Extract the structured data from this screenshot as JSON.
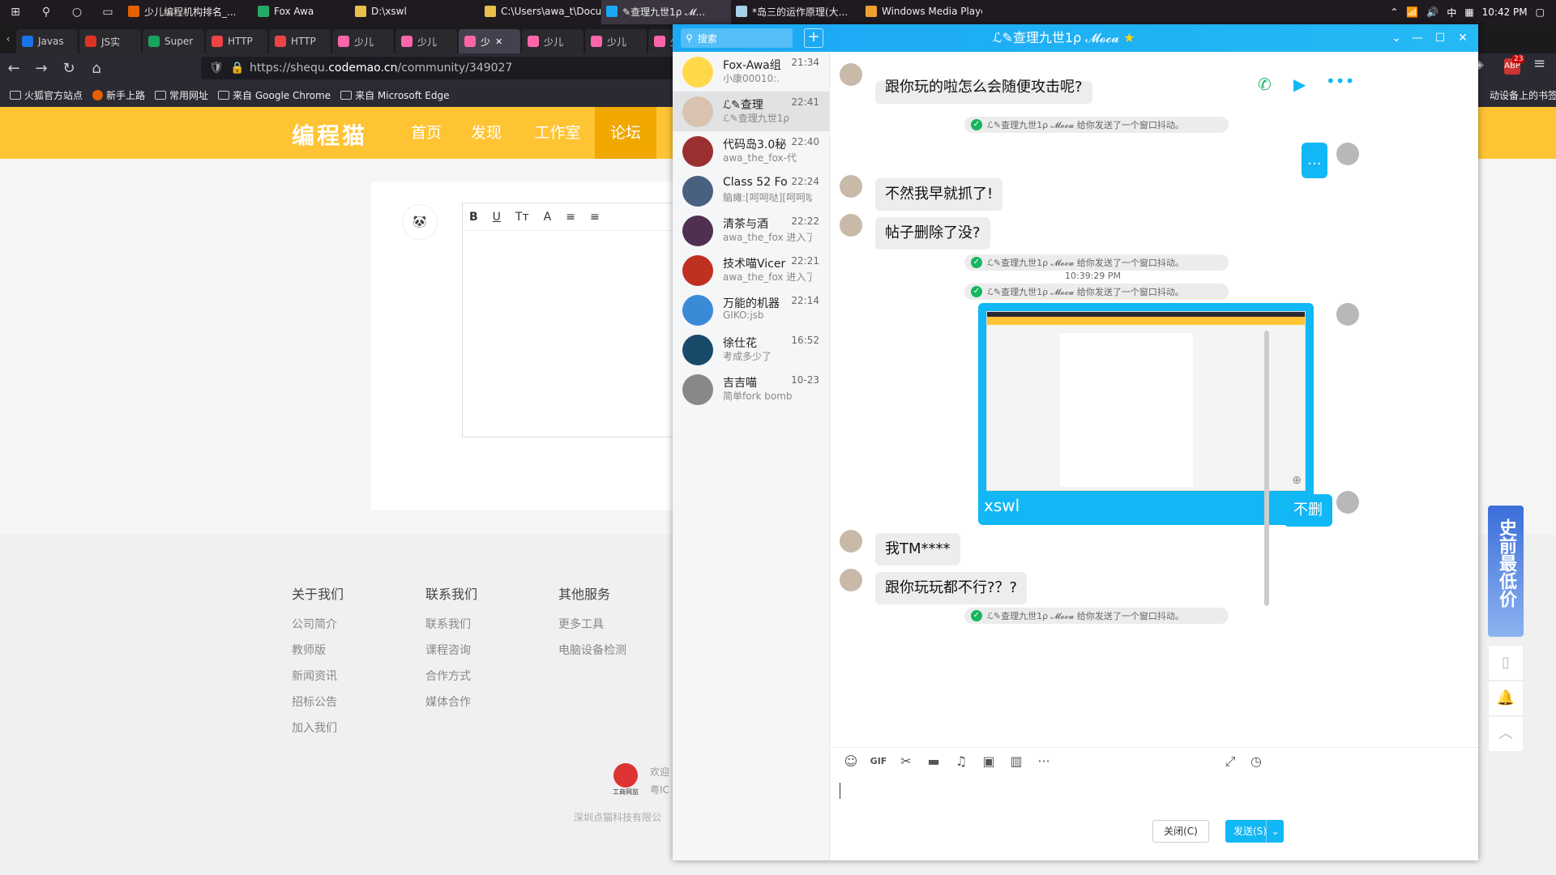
{
  "taskbar": {
    "tasks": [
      {
        "label": "少儿编程机构排名_...",
        "color": "#e66000"
      },
      {
        "label": "Fox Awa",
        "color": "#2a6"
      },
      {
        "label": "D:\\xswl",
        "color": "#e8c04a"
      },
      {
        "label": "C:\\Users\\awa_t\\Docu...",
        "color": "#e8c04a"
      },
      {
        "label": "✎查理九世1ρ 𝓜...",
        "color": "#1aa7f4"
      },
      {
        "label": "*岛三的运作原理(大...",
        "color": "#a8d0ea"
      },
      {
        "label": "Windows Media Player",
        "color": "#f0a030"
      }
    ],
    "tray": {
      "ime": "中",
      "time": "10:42 PM"
    }
  },
  "browser": {
    "tabs": [
      {
        "label": "Javas",
        "color": "#1a73e8"
      },
      {
        "label": "JS实",
        "color": "#d32"
      },
      {
        "label": "Super",
        "color": "#1aa260"
      },
      {
        "label": "HTTP",
        "color": "#e44"
      },
      {
        "label": "HTTP",
        "color": "#e44"
      },
      {
        "label": "少儿",
        "color": "#f6a"
      },
      {
        "label": "少儿",
        "color": "#f6a"
      },
      {
        "label": "少",
        "color": "#f6a",
        "active": true
      },
      {
        "label": "少儿",
        "color": "#f6a"
      },
      {
        "label": "少儿",
        "color": "#f6a"
      },
      {
        "label": "少",
        "color": "#f6a"
      }
    ],
    "url_prefix": "https://shequ.",
    "url_host": "codemao.cn",
    "url_path": "/community/349027",
    "bookmarks": [
      "火狐官方站点",
      "新手上路",
      "常用网址",
      "来自 Google Chrome",
      "来自 Microsoft Edge"
    ],
    "bookmarks_right": "动设备上的书签",
    "badge": "23"
  },
  "site": {
    "logo": "编程猫",
    "nav": [
      "首页",
      "发现",
      "工作室",
      "论坛"
    ],
    "editor_buttons": [
      "B",
      "U",
      "Tт",
      "A",
      "≡",
      "≡"
    ],
    "footer": {
      "col1": {
        "title": "关于我们",
        "items": [
          "公司简介",
          "教师版",
          "新闻资讯",
          "招标公告",
          "加入我们"
        ]
      },
      "col2": {
        "title": "联系我们",
        "items": [
          "联系我们",
          "课程咨询",
          "合作方式",
          "媒体合作"
        ]
      },
      "col3": {
        "title": "其他服务",
        "items": [
          "更多工具",
          "电脑设备检测"
        ]
      },
      "seal_text": "工商网监",
      "bottom1": "欢迎",
      "bottom2": "粤IC",
      "company": "深圳点猫科技有限公"
    }
  },
  "qq": {
    "search_placeholder": "搜索",
    "chat_name": "ℒ✎查理九世1ρ 𝓜𝓸𝓬𝓪",
    "conversations": [
      {
        "name": "Fox-Awa组",
        "time": "21:34",
        "msg": "小康00010:.",
        "color": "#ffd94a"
      },
      {
        "name": "ℒ✎查理",
        "time": "22:41",
        "msg": "ℒ✎查理九世1ρ",
        "color": "#d8c3b0",
        "selected": true
      },
      {
        "name": "代码岛3.0秘",
        "time": "22:40",
        "msg": "awa_the_fox-代",
        "color": "#9b3030"
      },
      {
        "name": "Class 52 Fo",
        "time": "22:24",
        "msg": "脑瘫:[呵呵哒][呵呵哒]",
        "color": "#4a6080"
      },
      {
        "name": "清茶与酒",
        "time": "22:22",
        "msg": "awa_the_fox 进入了",
        "color": "#503050"
      },
      {
        "name": "技术喵Vicer",
        "time": "22:21",
        "msg": "awa_the_fox 进入了",
        "color": "#c03020"
      },
      {
        "name": "万能的机器",
        "time": "22:14",
        "msg": "GIKO:jsb",
        "color": "#3a8ad8"
      },
      {
        "name": "徐仕花",
        "time": "16:52",
        "msg": "考成多少了",
        "color": "#1a4a6a"
      },
      {
        "name": "吉吉喵",
        "time": "10-23",
        "msg": "简单fork bomb",
        "color": "#888"
      }
    ],
    "messages": {
      "m0": "跟你玩的啦怎么会随便攻击呢?",
      "sys1": "ℒ✎查理九世1ρ 𝓜𝓸𝓬𝓪 给你发送了一个窗口抖动。",
      "m1": "...",
      "m2": "不然我早就抓了!",
      "m3": "帖子删除了没?",
      "sys2": "ℒ✎查理九世1ρ 𝓜𝓸𝓬𝓪 给你发送了一个窗口抖动。",
      "time1": "10:39:29 PM",
      "sys3": "ℒ✎查理九世1ρ 𝓜𝓸𝓬𝓪 给你发送了一个窗口抖动。",
      "img_caption": "xswl",
      "m4": "不删",
      "m5": "我TM****",
      "m6": "跟你玩玩都不行?？?",
      "sys4": "ℒ✎查理九世1ρ 𝓜𝓸𝓬𝓪 给你发送了一个窗口抖动。"
    },
    "close_btn": "关闭(C)",
    "send_btn": "发送(S)"
  },
  "ad": {
    "text": "史前最低价"
  }
}
